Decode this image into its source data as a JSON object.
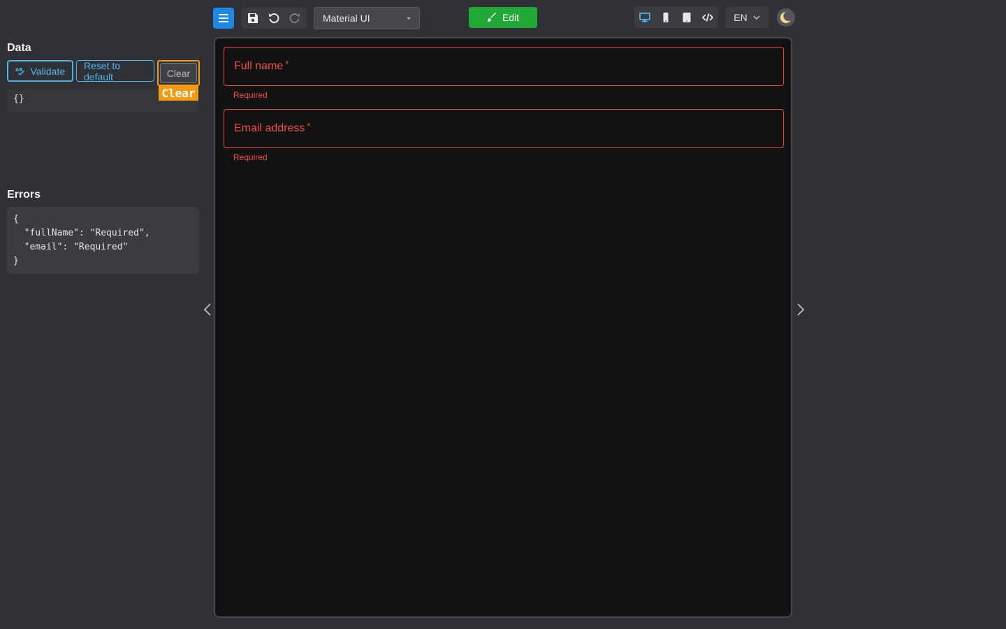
{
  "toolbar": {
    "theme_select_value": "Material UI",
    "edit_label": "Edit",
    "language": "EN"
  },
  "data_panel": {
    "title": "Data",
    "validate_label": "Validate",
    "reset_label": "Reset to default",
    "clear_label": "Clear",
    "clear_tag": "Clear",
    "json_value": "{}"
  },
  "errors_panel": {
    "title": "Errors",
    "json_value": "{\n  \"fullName\": \"Required\",\n  \"email\": \"Required\"\n}"
  },
  "form": {
    "fields": [
      {
        "label": "Full name",
        "required_mark": "*",
        "helper": "Required"
      },
      {
        "label": "Email address",
        "required_mark": "*",
        "helper": "Required"
      }
    ]
  },
  "colors": {
    "accent_blue": "#1e88e5",
    "edit_green": "#21a938",
    "error_red": "#ef4f44",
    "highlight_orange": "#f39c12"
  }
}
